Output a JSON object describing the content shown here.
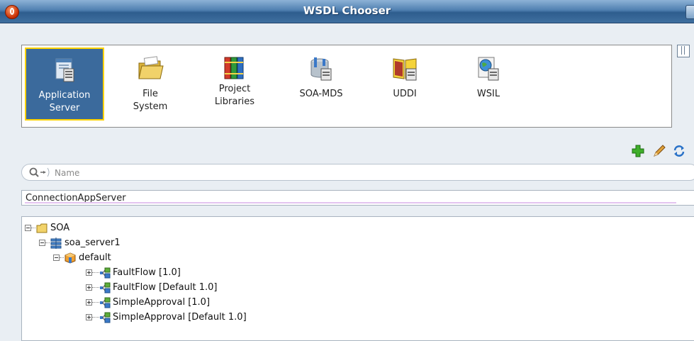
{
  "window": {
    "title": "WSDL Chooser"
  },
  "chooser": {
    "options": [
      {
        "label1": "Application",
        "label2": "Server",
        "icon": "application-server-icon"
      },
      {
        "label1": "File",
        "label2": "System",
        "icon": "folder-icon"
      },
      {
        "label1": "Project",
        "label2": "Libraries",
        "icon": "libraries-icon"
      },
      {
        "label1": "SOA-MDS",
        "label2": "",
        "icon": "soa-mds-icon"
      },
      {
        "label1": "UDDI",
        "label2": "",
        "icon": "uddi-book-icon"
      },
      {
        "label1": "WSIL",
        "label2": "",
        "icon": "wsil-icon"
      }
    ],
    "selected": "Application Server"
  },
  "toolbar": {
    "icons": [
      "add-icon",
      "edit-icon",
      "refresh-icon"
    ]
  },
  "search": {
    "placeholder": "Name",
    "value": ""
  },
  "connection": {
    "selected": "ConnectionAppServer"
  },
  "tree": {
    "nodes": [
      {
        "label": "SOA",
        "icon": "folder-icon",
        "expanded": true
      },
      {
        "label": "soa_server1",
        "icon": "server-icon",
        "expanded": true
      },
      {
        "label": "default",
        "icon": "partition-icon",
        "expanded": true
      },
      {
        "label": "FaultFlow [1.0]",
        "icon": "composite-icon",
        "expanded": false
      },
      {
        "label": "FaultFlow [Default 1.0]",
        "icon": "composite-icon",
        "expanded": false
      },
      {
        "label": "SimpleApproval [1.0]",
        "icon": "composite-icon",
        "expanded": false
      },
      {
        "label": "SimpleApproval [Default 1.0]",
        "icon": "composite-icon",
        "expanded": false
      }
    ]
  },
  "colors": {
    "title_bar": "#3f6f9f",
    "selected_option": "#3b6a9c",
    "selection_border": "#ffd200"
  }
}
